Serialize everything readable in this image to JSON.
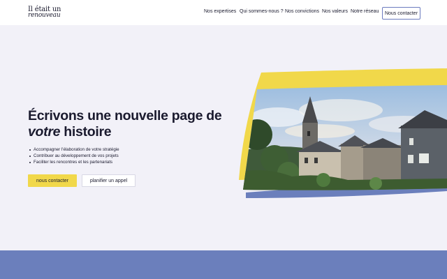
{
  "header": {
    "logo": {
      "line1": "Il était un",
      "line2": "renouveau"
    },
    "nav": [
      {
        "label": "Nos expertises"
      },
      {
        "label": "Qui sommes-nous ?"
      },
      {
        "label": "Nos convictions"
      },
      {
        "label": "Nos valeurs"
      },
      {
        "label": "Notre réseau"
      }
    ],
    "contact_label": "Nous contacter"
  },
  "hero": {
    "title_line1": "Écrivons une nouvelle page de",
    "title_em": "votre",
    "title_rest": " histoire",
    "bullets": [
      "Accompagner l'élaboration de votre stratégie",
      "Contribuer au développement de vos projets",
      "Faciliter les rencontres et les partenariats"
    ],
    "primary_button": "nous contacter",
    "secondary_button": "planifier un appel"
  },
  "colors": {
    "accent_yellow": "#f1d84a",
    "accent_blue": "#6b7fbc",
    "background": "#f2f1f8"
  }
}
